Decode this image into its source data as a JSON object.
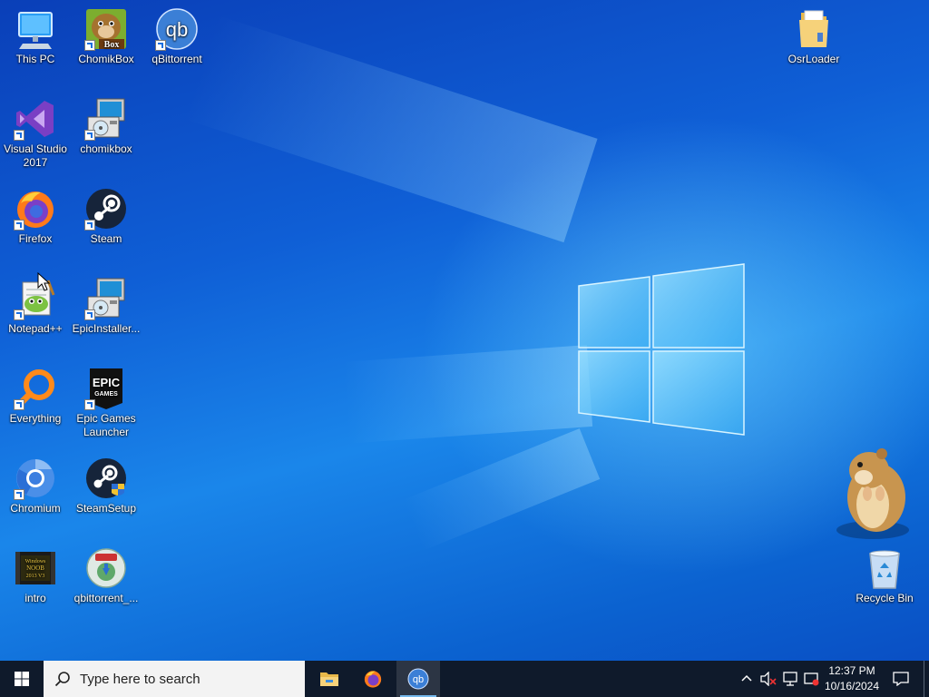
{
  "desktop": {
    "icons": [
      {
        "id": "this-pc",
        "label": "This PC"
      },
      {
        "id": "chomikbox-shortcut",
        "label": "ChomikBox",
        "badge": "Box"
      },
      {
        "id": "qbittorrent",
        "label": "qBittorrent",
        "badge": "qb"
      },
      {
        "id": "osrloader",
        "label": "OsrLoader"
      },
      {
        "id": "visual-studio",
        "label": "Visual Studio 2017"
      },
      {
        "id": "chomikbox-installer",
        "label": "chomikbox"
      },
      {
        "id": "firefox",
        "label": "Firefox"
      },
      {
        "id": "steam",
        "label": "Steam"
      },
      {
        "id": "notepadpp",
        "label": "Notepad++"
      },
      {
        "id": "epic-installer",
        "label": "EpicInstaller..."
      },
      {
        "id": "everything",
        "label": "Everything"
      },
      {
        "id": "epic-games-launcher",
        "label": "Epic Games Launcher",
        "badge": "EPIC",
        "badge2": "GAMES"
      },
      {
        "id": "chromium",
        "label": "Chromium"
      },
      {
        "id": "steamsetup",
        "label": "SteamSetup"
      },
      {
        "id": "intro",
        "label": "intro",
        "badge": "Windows NOOB 2013 V3"
      },
      {
        "id": "qbittorrent-installer",
        "label": "qbittorrent_..."
      },
      {
        "id": "recycle-bin",
        "label": "Recycle Bin"
      }
    ]
  },
  "taskbar": {
    "search_placeholder": "Type here to search",
    "pinned": [
      "file-explorer",
      "firefox",
      "qbittorrent"
    ],
    "active_app": "qbittorrent",
    "qb_badge": "qb",
    "clock_time": "12:37 PM",
    "clock_date": "10/16/2024"
  },
  "colors": {
    "desktop_blue": "#0f5fd6",
    "taskbar_bg": "#0f1a2b",
    "accent": "#76b9ed"
  }
}
